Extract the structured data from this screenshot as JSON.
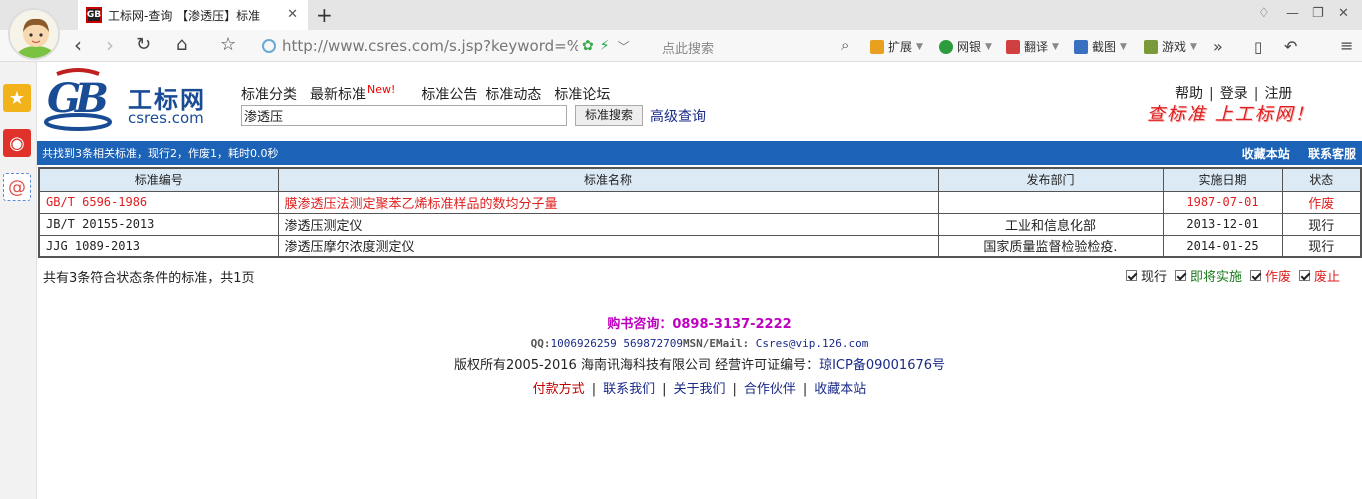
{
  "browser": {
    "tab_title": "工标网-查询 【渗透压】标准",
    "tab_favicon": "GB",
    "url": "http://www.csres.com/s.jsp?keyword=%",
    "search_placeholder": "点此搜索",
    "extensions": [
      {
        "label": "扩展",
        "icon": "grid-icon",
        "color": "#e8a020"
      },
      {
        "label": "网银",
        "icon": "bank-icon",
        "color": "#2c9c3c"
      },
      {
        "label": "翻译",
        "icon": "translate-icon",
        "color": "#d04040"
      },
      {
        "label": "截图",
        "icon": "scissors-icon",
        "color": "#3a70c0"
      },
      {
        "label": "游戏",
        "icon": "gamepad-icon",
        "color": "#7a9a3a"
      }
    ]
  },
  "site": {
    "logo_cn": "工标网",
    "logo_en": "csres.com",
    "nav": [
      "标准分类",
      "最新标准",
      "标准公告",
      "标准动态",
      "标准论坛"
    ],
    "nav_new_badge": "New!",
    "query_value": "渗透压",
    "search_button": "标准搜索",
    "advanced_link": "高级查询",
    "user_links": [
      "帮助",
      "登录",
      "注册"
    ],
    "slogan": "查标准 上工标网！"
  },
  "result_bar": {
    "summary": "共找到3条相关标准，现行2，作废1，耗时0.0秒",
    "bookmark": "收藏本站",
    "support": "联系客服"
  },
  "table": {
    "headers": [
      "标准编号",
      "标准名称",
      "发布部门",
      "实施日期",
      "状态"
    ],
    "rows": [
      {
        "code": "GB/T 6596-1986",
        "name": "膜渗透压法测定聚苯乙烯标准样品的数均分子量",
        "dept": "",
        "date": "1987-07-01",
        "state": "作废"
      },
      {
        "code": "JB/T 20155-2013",
        "name": "渗透压测定仪",
        "dept": "工业和信息化部",
        "date": "2013-12-01",
        "state": "现行"
      },
      {
        "code": "JJG 1089-2013",
        "name": "渗透压摩尔浓度测定仪",
        "dept": "国家质量监督检验检疫.",
        "date": "2014-01-25",
        "state": "现行"
      }
    ]
  },
  "summary_text": "共有3条符合状态条件的标准，共1页",
  "filters": [
    {
      "label": "现行",
      "color": "#222222"
    },
    {
      "label": "即将实施",
      "color": "#1a7a1a"
    },
    {
      "label": "作废",
      "color": "#e02020"
    },
    {
      "label": "废止",
      "color": "#e02020"
    }
  ],
  "footer": {
    "hotline": "购书咨询：0898-3137-2222",
    "qq_label": "QQ:",
    "qq_value": "1006926259 569872709",
    "msn_label": "MSN/EMail:",
    "email": "Csres@vip.126.com",
    "copyright": "版权所有2005-2016 海南讯海科技有限公司 经营许可证编号：",
    "icp": "琼ICP备09001676号",
    "links": [
      "付款方式",
      "联系我们",
      "关于我们",
      "合作伙伴",
      "收藏本站"
    ]
  }
}
